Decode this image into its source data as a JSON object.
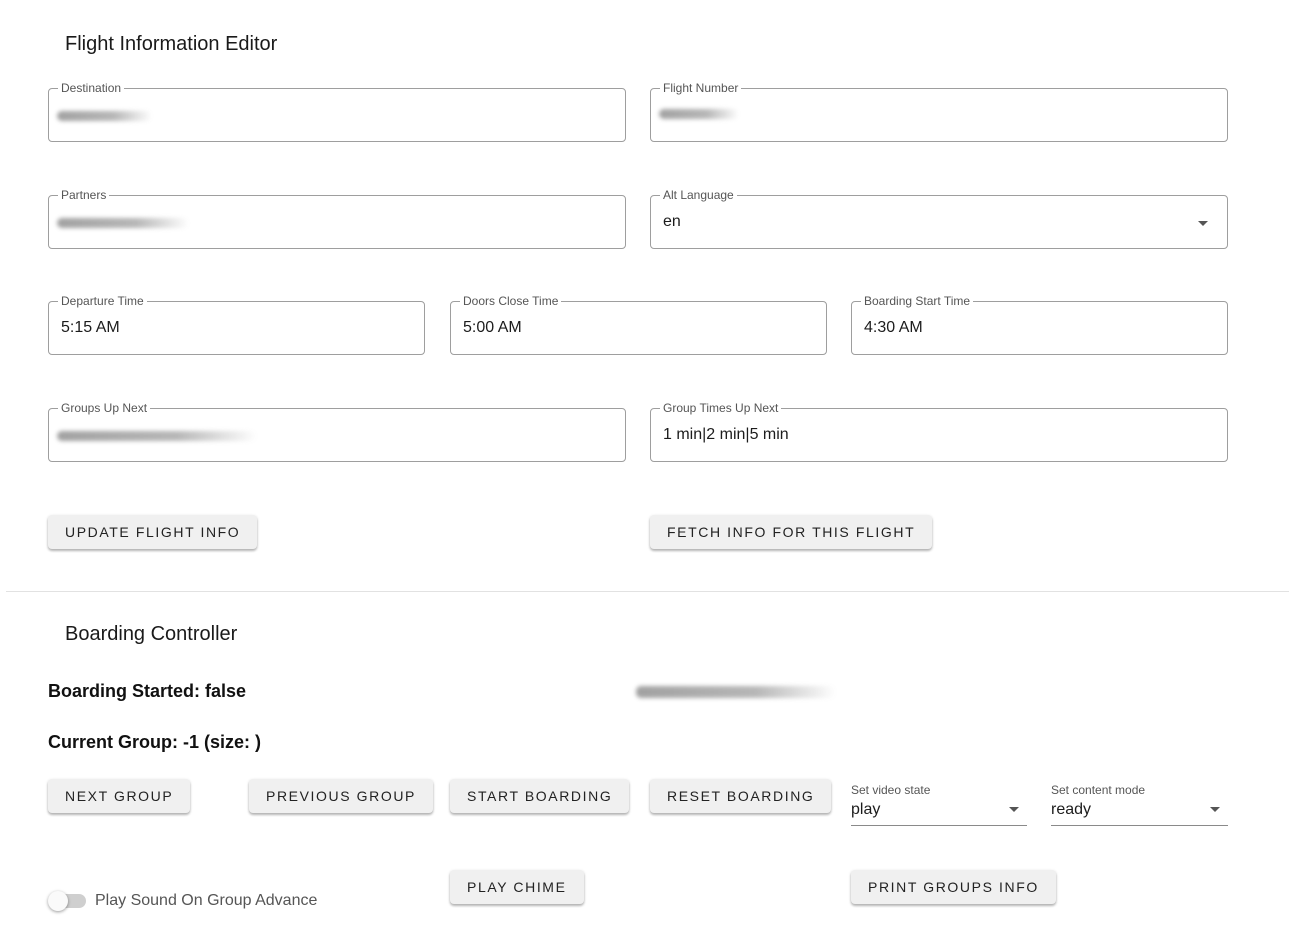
{
  "flight_editor": {
    "title": "Flight Information Editor",
    "destination": {
      "label": "Destination",
      "value": ""
    },
    "flight_number": {
      "label": "Flight Number",
      "value": ""
    },
    "partners": {
      "label": "Partners",
      "value": ""
    },
    "alt_language": {
      "label": "Alt Language",
      "value": "en"
    },
    "departure_time": {
      "label": "Departure Time",
      "value": "5:15 AM"
    },
    "doors_close_time": {
      "label": "Doors Close Time",
      "value": "5:00 AM"
    },
    "boarding_start_time": {
      "label": "Boarding Start Time",
      "value": "4:30 AM"
    },
    "groups_up_next": {
      "label": "Groups Up Next",
      "value": ""
    },
    "group_times_up_next": {
      "label": "Group Times Up Next",
      "value": "1 min|2 min|5 min"
    },
    "update_button": "UPDATE FLIGHT INFO",
    "fetch_button": "FETCH INFO FOR THIS FLIGHT"
  },
  "boarding_controller": {
    "title": "Boarding Controller",
    "boarding_started": "Boarding Started: false",
    "current_group": "Current Group: -1 (size: )",
    "next_group_button": "NEXT GROUP",
    "previous_group_button": "PREVIOUS GROUP",
    "start_boarding_button": "START BOARDING",
    "reset_boarding_button": "RESET BOARDING",
    "video_state": {
      "label": "Set video state",
      "value": "play"
    },
    "content_mode": {
      "label": "Set content mode",
      "value": "ready"
    },
    "play_chime_button": "PLAY CHIME",
    "print_groups_button": "PRINT GROUPS INFO",
    "sound_toggle": {
      "label": "Play Sound On Group Advance",
      "on": false
    }
  },
  "icons": {
    "dropdown": "chevron-down-icon"
  },
  "colors": {
    "outline": "#9e9e9e",
    "button_bg": "#f0f0f0",
    "toggle_track": "#cfcfcf"
  }
}
